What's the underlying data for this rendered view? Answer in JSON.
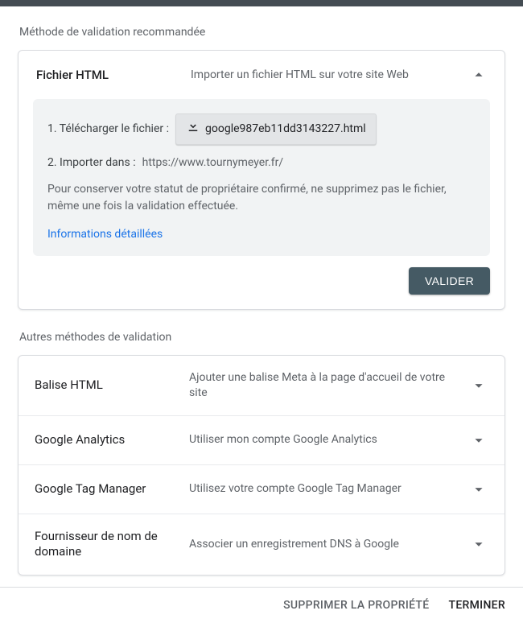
{
  "recommended": {
    "heading": "Méthode de validation recommandée",
    "panel": {
      "title": "Fichier HTML",
      "desc": "Importer un fichier HTML sur votre site Web",
      "step1_label": "1. Télécharger le fichier :",
      "download_filename": "google987eb11dd3143227.html",
      "step2_label": "2. Importer dans :",
      "step2_url": "https://www.tournymeyer.fr/",
      "note": "Pour conserver votre statut de propriétaire confirmé, ne supprimez pas le fichier, même une fois la validation effectuée.",
      "details_link": "Informations détaillées",
      "validate_label": "VALIDER"
    }
  },
  "other": {
    "heading": "Autres méthodes de validation",
    "methods": [
      {
        "title": "Balise HTML",
        "desc": "Ajouter une balise Meta à la page d'accueil de votre site"
      },
      {
        "title": "Google Analytics",
        "desc": "Utiliser mon compte Google Analytics"
      },
      {
        "title": "Google Tag Manager",
        "desc": "Utilisez votre compte Google Tag Manager"
      },
      {
        "title": "Fournisseur de nom de domaine",
        "desc": "Associer un enregistrement DNS à Google"
      }
    ]
  },
  "footer": {
    "remove": "SUPPRIMER LA PROPRIÉTÉ",
    "finish": "TERMINER"
  }
}
